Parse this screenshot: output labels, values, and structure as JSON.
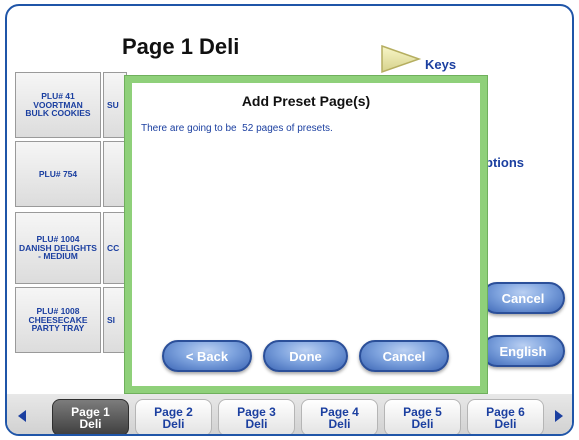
{
  "header": {
    "title": "Page 1 Deli",
    "keys_label": "Keys"
  },
  "background_text": {
    "options": "ptions"
  },
  "plu_buttons": [
    {
      "label": "PLU# 41\nVOORTMAN\nBULK COOKIES",
      "second": "SU"
    },
    {
      "label": "PLU# 754",
      "second": ""
    },
    {
      "label": "PLU# 1004\nDANISH DELIGHTS\n- MEDIUM",
      "second": "CC"
    },
    {
      "label": "PLU# 1008\nCHEESECAKE\nPARTY TRAY",
      "second": "SI"
    }
  ],
  "right_buttons": {
    "cancel": "Cancel",
    "english": "English"
  },
  "modal": {
    "title": "Add Preset Page(s)",
    "message": "There are going to be  52 pages of presets.",
    "back_label": "< Back",
    "done_label": "Done",
    "cancel_label": "Cancel"
  },
  "page_tabs": [
    {
      "label": "Page 1\nDeli"
    },
    {
      "label": "Page 2\nDeli"
    },
    {
      "label": "Page 3\nDeli"
    },
    {
      "label": "Page 4\nDeli"
    },
    {
      "label": "Page 5\nDeli"
    },
    {
      "label": "Page 6\nDeli"
    }
  ],
  "colors": {
    "accent_blue": "#1b3fa0",
    "modal_border": "#8fd07a",
    "frame": "#1f55a8"
  }
}
